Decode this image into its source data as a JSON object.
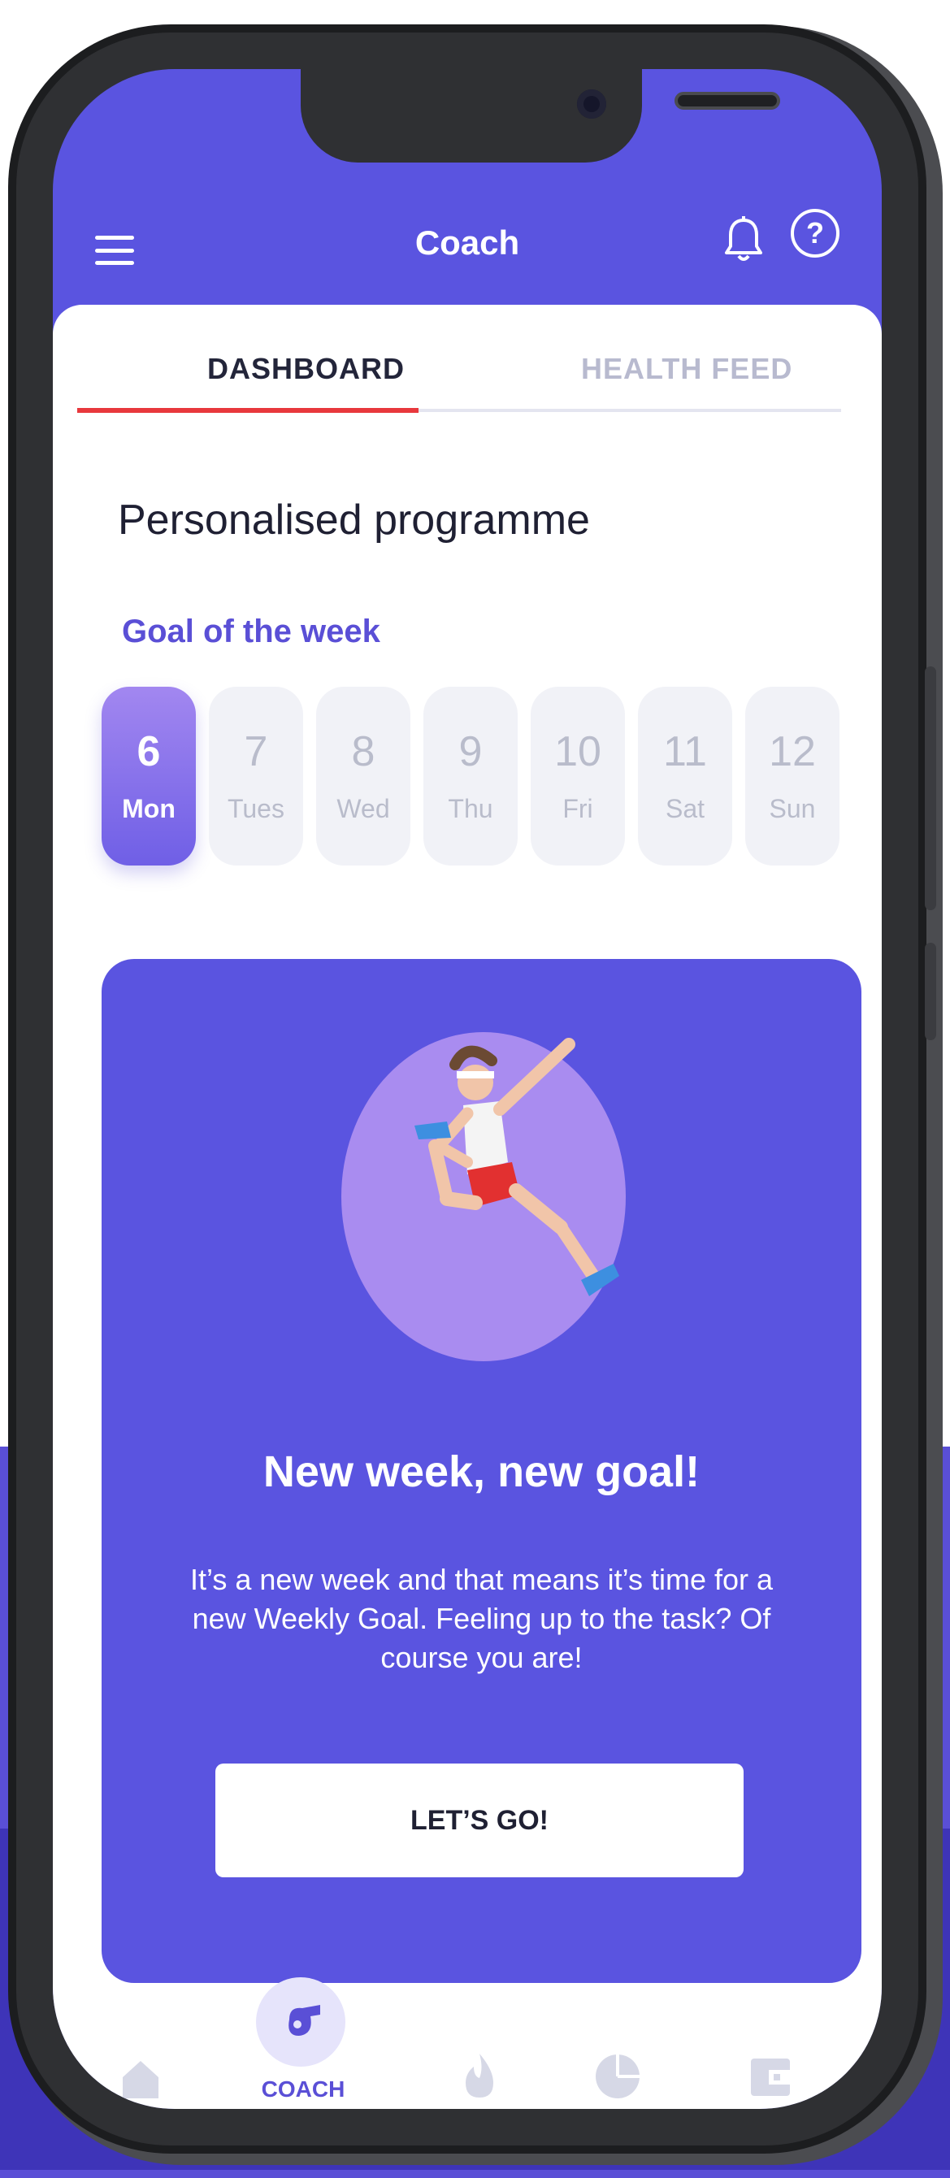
{
  "app": {
    "title": "Coach",
    "tabs": [
      {
        "label": "DASHBOARD",
        "active": true
      },
      {
        "label": "HEALTH FEED",
        "active": false
      }
    ],
    "accent_color": "#5a4fd6",
    "tab_underline_color": "#e8383d"
  },
  "main": {
    "heading": "Personalised programme",
    "goal_label": "Goal of the week",
    "days": [
      {
        "num": "6",
        "label": "Mon",
        "selected": true
      },
      {
        "num": "7",
        "label": "Tues",
        "selected": false
      },
      {
        "num": "8",
        "label": "Wed",
        "selected": false
      },
      {
        "num": "9",
        "label": "Thu",
        "selected": false
      },
      {
        "num": "10",
        "label": "Fri",
        "selected": false
      },
      {
        "num": "11",
        "label": "Sat",
        "selected": false
      },
      {
        "num": "12",
        "label": "Sun",
        "selected": false
      }
    ],
    "card": {
      "title": "New week, new goal!",
      "text": "It’s a new week and that means it’s time for a new Weekly Goal. Feeling up to the task? Of course you are!",
      "button_label": "LET’S GO!"
    }
  },
  "bottom_nav": {
    "items": [
      {
        "icon": "home-icon"
      },
      {
        "icon": "whistle-icon",
        "label": "COACH",
        "active": true
      },
      {
        "icon": "flame-icon"
      },
      {
        "icon": "pie-chart-icon"
      },
      {
        "icon": "wallet-icon"
      }
    ]
  }
}
